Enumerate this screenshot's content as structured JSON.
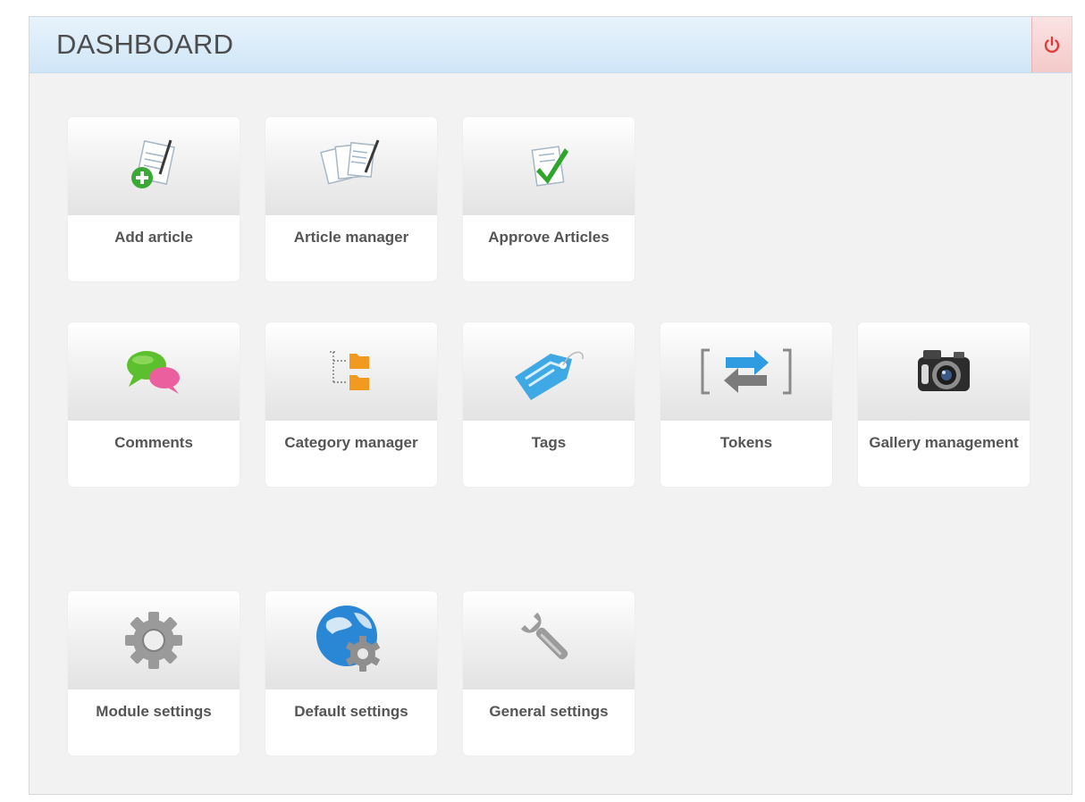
{
  "header": {
    "title": "DASHBOARD",
    "logout_icon": "power-icon",
    "logout_color": "#e03a3a"
  },
  "tiles": [
    {
      "label": "Add article",
      "icon": "add-article-icon"
    },
    {
      "label": "Article manager",
      "icon": "documents-icon"
    },
    {
      "label": "Approve Articles",
      "icon": "approve-check-icon"
    },
    {
      "label": "Comments",
      "icon": "speech-bubbles-icon"
    },
    {
      "label": "Category manager",
      "icon": "folder-tree-icon"
    },
    {
      "label": "Tags",
      "icon": "tag-icon"
    },
    {
      "label": "Tokens",
      "icon": "exchange-arrows-icon"
    },
    {
      "label": "Gallery management",
      "icon": "camera-icon"
    },
    {
      "label": "Module settings",
      "icon": "gear-icon"
    },
    {
      "label": "Default settings",
      "icon": "globe-gear-icon"
    },
    {
      "label": "General settings",
      "icon": "wrench-icon"
    }
  ]
}
